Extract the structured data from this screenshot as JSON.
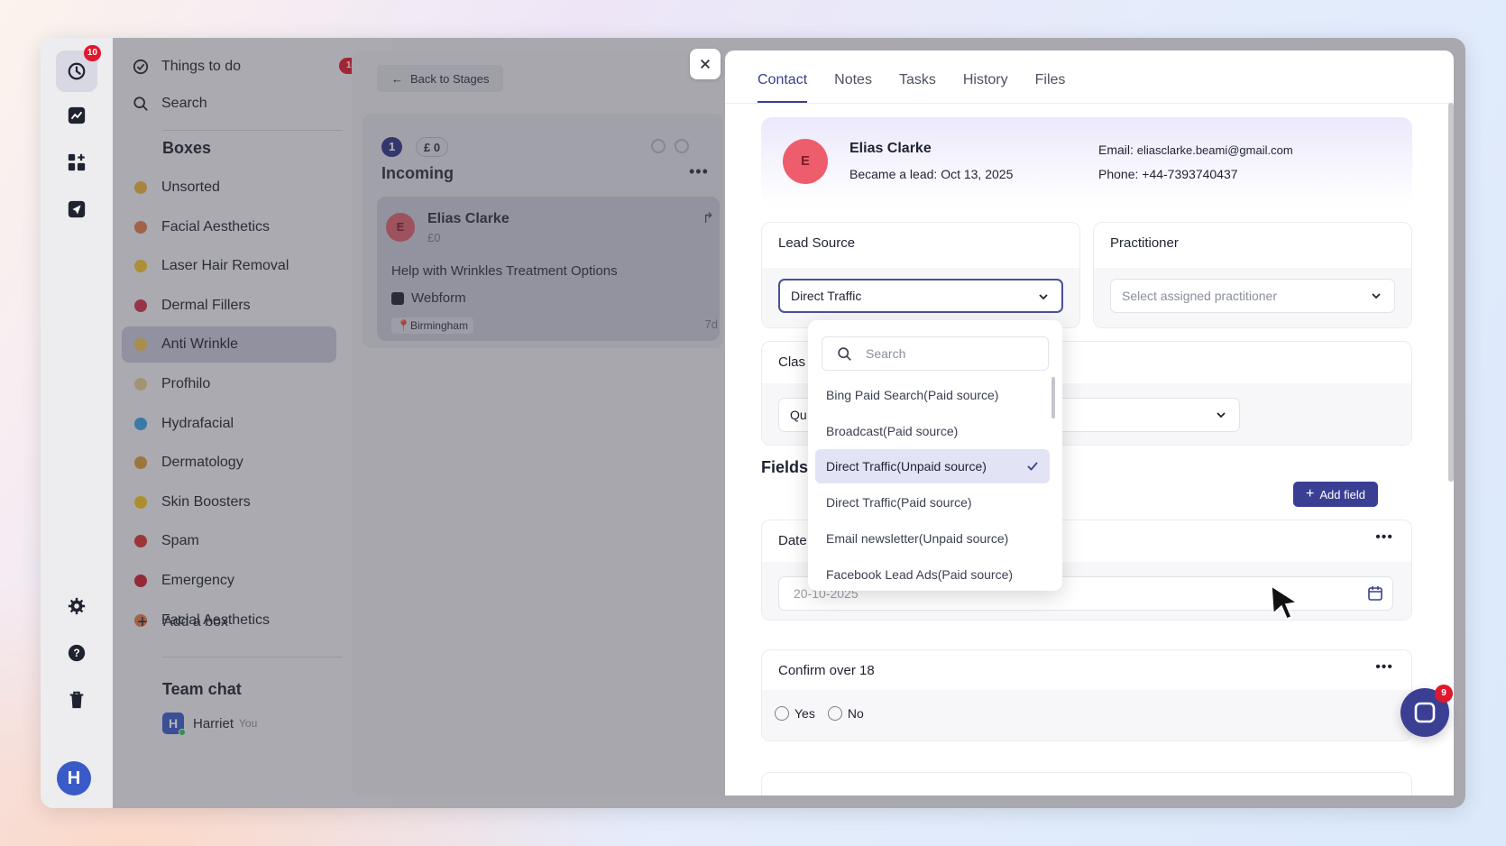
{
  "rail": {
    "logo_badge": "10"
  },
  "sidebar": {
    "things_to_do": "Things to do",
    "things_count": "10",
    "search": "Search",
    "boxes_heading": "Boxes",
    "boxes": [
      {
        "label": "Unsorted",
        "icon": "smile-emoji-icon",
        "color": "#e8b23a"
      },
      {
        "label": "Facial Aesthetics",
        "icon": "face-emoji-icon",
        "color": "#e07a4a"
      },
      {
        "label": "Laser Hair Removal",
        "icon": "lightning-emoji-icon",
        "color": "#f2c230"
      },
      {
        "label": "Dermal Fillers",
        "icon": "lips-emoji-icon",
        "color": "#d0304a"
      },
      {
        "label": "Anti Wrinkle",
        "icon": "sparkle-emoji-icon",
        "color": "#e8c050"
      },
      {
        "label": "Profhilo",
        "icon": "syringe-emoji-icon",
        "color": "#e0c890"
      },
      {
        "label": "Hydrafacial",
        "icon": "droplets-emoji-icon",
        "color": "#3a9ee0"
      },
      {
        "label": "Dermatology",
        "icon": "face-emoji-icon",
        "color": "#d89a3a"
      },
      {
        "label": "Skin Boosters",
        "icon": "heart-emoji-icon",
        "color": "#f0c020"
      },
      {
        "label": "Spam",
        "icon": "no-entry-emoji-icon",
        "color": "#d83030"
      },
      {
        "label": "Emergency",
        "icon": "alarm-emoji-icon",
        "color": "#c82030"
      },
      {
        "label": "Facial Aesthetics",
        "icon": "face-emoji-icon",
        "color": "#e07a4a"
      }
    ],
    "add_box": "Add a box",
    "team_chat_heading": "Team chat",
    "team_member": "Harriet",
    "team_member_tag": "You",
    "user_initial": "H"
  },
  "board": {
    "back_label": "Back to Stages",
    "count_pill": "1",
    "value_pill": "£ 0",
    "column_title": "Incoming",
    "card": {
      "initial": "E",
      "name": "Elias Clarke",
      "value": "£0",
      "title": "Help with Wrinkles Treatment Options",
      "source": "Webform",
      "location": "Birmingham",
      "age": "7d"
    }
  },
  "drawer": {
    "tabs": [
      "Contact",
      "Notes",
      "Tasks",
      "History",
      "Files"
    ],
    "active_tab": "Contact",
    "contact": {
      "initial": "E",
      "name": "Elias Clarke",
      "became_lead_label": "Became a lead:",
      "became_lead_date": "Oct 13, 2025",
      "email_label": "Email:",
      "email": "eliasclarke.beami@gmail.com",
      "phone_label": "Phone:",
      "phone": "+44-7393740437"
    },
    "lead_source": {
      "title": "Lead Source",
      "value": "Direct Traffic"
    },
    "practitioner": {
      "title": "Practitioner",
      "placeholder": "Select assigned practitioner"
    },
    "classification": {
      "title_partial": "Clas",
      "value_partial": "Qu"
    },
    "fields_heading": "Fields",
    "add_field": "Add field",
    "date_field": {
      "title_partial": "Date",
      "value": "20-10-2025"
    },
    "confirm_field": {
      "title": "Confirm over 18",
      "options": [
        "Yes",
        "No"
      ]
    }
  },
  "dropdown": {
    "search_placeholder": "Search",
    "items": [
      "Bing Paid Search(Paid source)",
      "Broadcast(Paid source)",
      "Direct Traffic(Unpaid source)",
      "Direct Traffic(Paid source)",
      "Email newsletter(Unpaid source)",
      "Facebook Lead Ads(Paid source)"
    ],
    "selected": "Direct Traffic(Unpaid source)"
  },
  "chat": {
    "badge": "9"
  },
  "colors": {
    "accent": "#3b3f94",
    "badge_red": "#e0182d",
    "avatar_red": "#ee5d6c",
    "user_blue": "#3a5bc7"
  }
}
